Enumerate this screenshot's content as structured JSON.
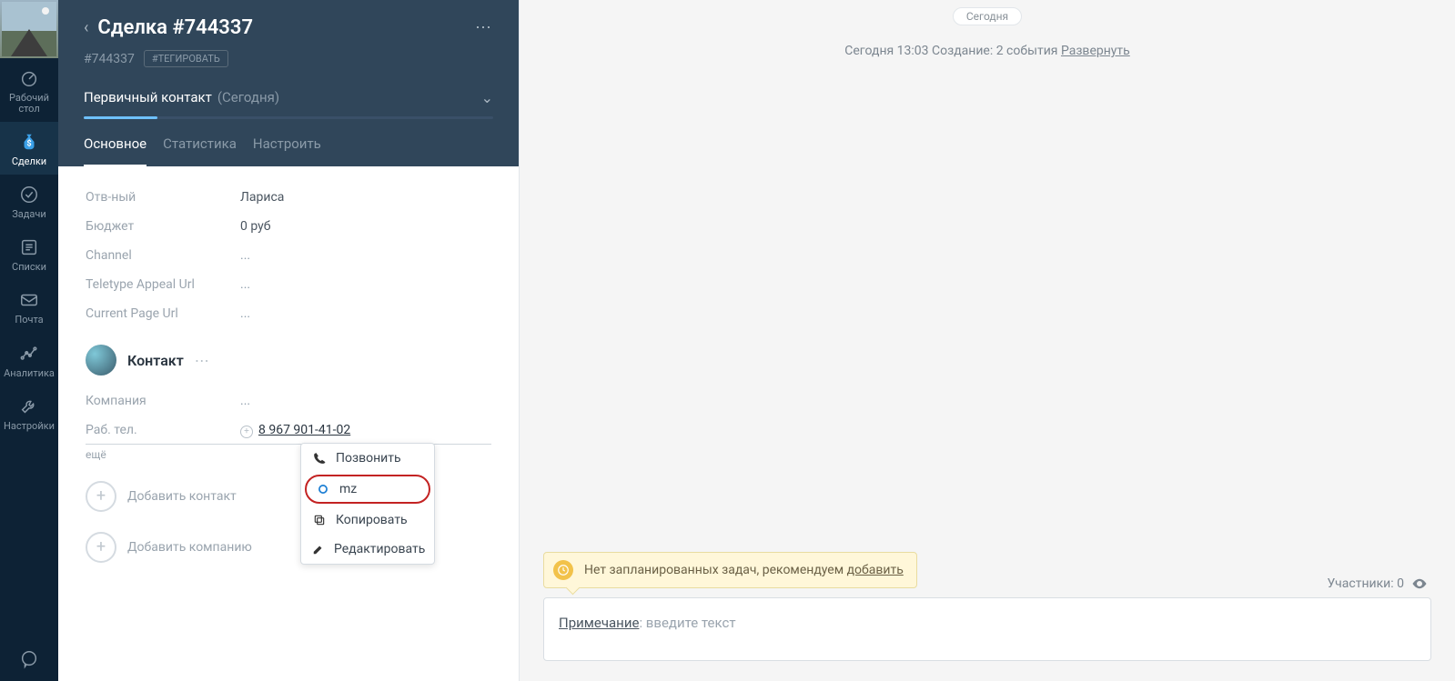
{
  "nav": {
    "items": [
      {
        "label": "Рабочий стол"
      },
      {
        "label": "Сделки"
      },
      {
        "label": "Задачи"
      },
      {
        "label": "Списки"
      },
      {
        "label": "Почта"
      },
      {
        "label": "Аналитика"
      },
      {
        "label": "Настройки"
      }
    ]
  },
  "deal": {
    "title": "Сделка #744337",
    "id": "#744337",
    "tag_button": "#ТЕГИРОВАТЬ",
    "pipeline_stage": "Первичный контакт",
    "pipeline_note": "(Сегодня)",
    "tabs": {
      "main": "Основное",
      "stats": "Статистика",
      "setup": "Настроить"
    },
    "fields": {
      "responsible": {
        "label": "Отв-ный",
        "value": "Лариса"
      },
      "budget": {
        "label": "Бюджет",
        "value": "0",
        "unit": "руб"
      },
      "channel": {
        "label": "Channel",
        "value": "..."
      },
      "teletype": {
        "label": "Teletype Appeal Url",
        "value": "..."
      },
      "page_url": {
        "label": "Current Page Url",
        "value": "..."
      }
    },
    "contact": {
      "heading": "Контакт",
      "company": {
        "label": "Компания",
        "value": "..."
      },
      "phone": {
        "label": "Раб. тел.",
        "value": "8 967 901-41-02"
      },
      "more": "ещё"
    },
    "add_contact": "Добавить контакт",
    "add_company": "Добавить компанию"
  },
  "context_menu": {
    "call": "Позвонить",
    "mz": "mz",
    "copy": "Копировать",
    "edit": "Редактировать"
  },
  "feed": {
    "day_pill": "Сегодня",
    "summary": "Сегодня 13:03 Создание: 2 события ",
    "expand": "Развернуть",
    "task_banner": "Нет запланированных задач, рекомендуем ",
    "task_add": "добавить",
    "participants_label": "Участники: 0",
    "note_label": "Примечание",
    "note_placeholder": ": введите текст"
  }
}
